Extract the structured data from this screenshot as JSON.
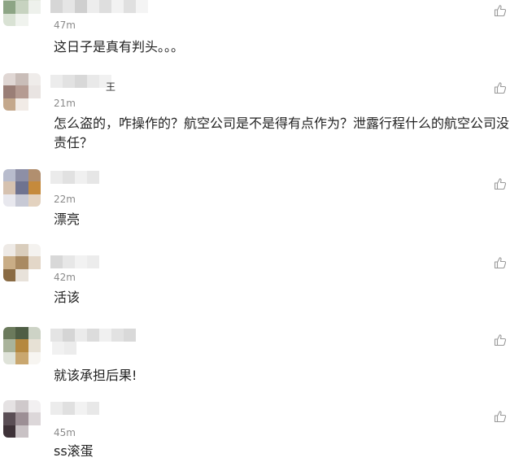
{
  "comments": [
    {
      "time": "47m",
      "text": "这日子是真有判头。。。"
    },
    {
      "time": "21m",
      "text": "怎么盗的，咋操作的？航空公司是不是得有点作为？泄露行程什么的航空公司没责任？",
      "name_suffix": "王"
    },
    {
      "time": "22m",
      "text": "漂亮"
    },
    {
      "time": "42m",
      "text": "活该"
    },
    {
      "time": "",
      "text": "就该承担后果!"
    },
    {
      "time": "45m",
      "text": "ss滚蛋"
    }
  ],
  "icons": {
    "like": "thumbs-up-icon",
    "like_color": "#999999"
  },
  "colors": {
    "text": "#222222",
    "time": "#8a8a8a"
  }
}
